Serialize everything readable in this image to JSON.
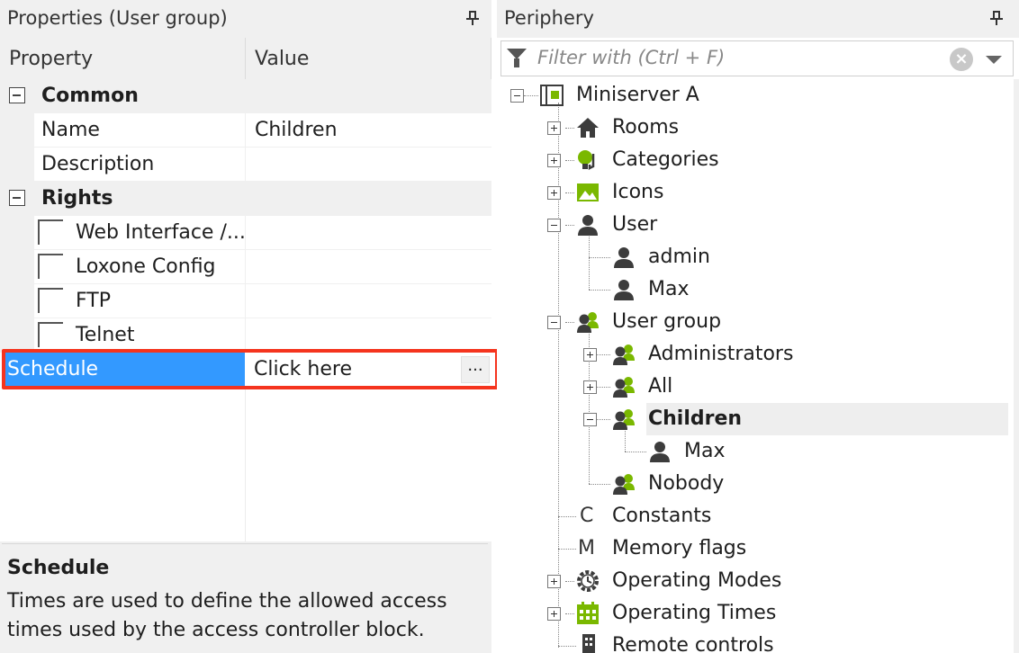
{
  "properties": {
    "title": "Properties (User group)",
    "col_property": "Property",
    "col_value": "Value",
    "common": {
      "label": "Common",
      "name_label": "Name",
      "name_value": "Children",
      "description_label": "Description",
      "description_value": ""
    },
    "rights": {
      "label": "Rights",
      "items": [
        "Web Interface /...",
        "Loxone Config",
        "FTP",
        "Telnet"
      ]
    },
    "schedule": {
      "label": "Schedule",
      "value": "Click here",
      "button": "..."
    },
    "description_panel": {
      "title": "Schedule",
      "text": "Times are used to define the allowed access times used by the access controller block."
    }
  },
  "periphery": {
    "title": "Periphery",
    "filter_placeholder": "Filter with (Ctrl + F)",
    "clear_glyph": "×",
    "tree": {
      "root": "Miniserver A",
      "rooms": "Rooms",
      "categories": "Categories",
      "icons": "Icons",
      "user": "User",
      "user_children": [
        "admin",
        "Max"
      ],
      "user_group": "User group",
      "groups": [
        "Administrators",
        "All",
        "Children",
        "Nobody"
      ],
      "children_members": [
        "Max"
      ],
      "constants": "Constants",
      "constants_glyph": "C",
      "memory_flags": "Memory flags",
      "memory_glyph": "M",
      "operating_modes": "Operating Modes",
      "operating_times": "Operating Times",
      "remote_controls": "Remote controls"
    }
  },
  "colors": {
    "selection_blue": "#3399ff",
    "highlight_red": "#f5341e",
    "icon_green": "#7ab800",
    "icon_dark": "#3c3c3c"
  }
}
